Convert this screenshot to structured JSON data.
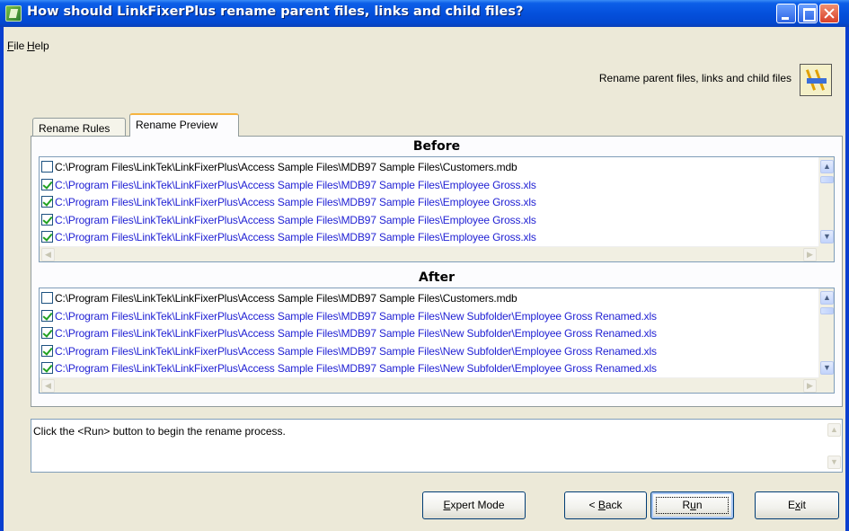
{
  "window": {
    "title": "How should LinkFixerPlus rename parent files, links and child files?"
  },
  "menu": {
    "file": "File",
    "help": "Help"
  },
  "header": {
    "text": "Rename parent files, links and child files"
  },
  "tabs": [
    {
      "label": "Rename Rules",
      "active": false
    },
    {
      "label": "Rename Preview",
      "active": true
    }
  ],
  "before": {
    "title": "Before",
    "rows": [
      {
        "checked": false,
        "blue": false,
        "text": "C:\\Program Files\\LinkTek\\LinkFixerPlus\\Access Sample Files\\MDB97 Sample Files\\Customers.mdb"
      },
      {
        "checked": true,
        "blue": true,
        "text": "C:\\Program Files\\LinkTek\\LinkFixerPlus\\Access Sample Files\\MDB97 Sample Files\\Employee Gross.xls"
      },
      {
        "checked": true,
        "blue": true,
        "text": "C:\\Program Files\\LinkTek\\LinkFixerPlus\\Access Sample Files\\MDB97 Sample Files\\Employee Gross.xls"
      },
      {
        "checked": true,
        "blue": true,
        "text": "C:\\Program Files\\LinkTek\\LinkFixerPlus\\Access Sample Files\\MDB97 Sample Files\\Employee Gross.xls"
      },
      {
        "checked": true,
        "blue": true,
        "text": "C:\\Program Files\\LinkTek\\LinkFixerPlus\\Access Sample Files\\MDB97 Sample Files\\Employee Gross.xls"
      }
    ]
  },
  "after": {
    "title": "After",
    "rows": [
      {
        "checked": false,
        "blue": false,
        "text": "C:\\Program Files\\LinkTek\\LinkFixerPlus\\Access Sample Files\\MDB97 Sample Files\\Customers.mdb"
      },
      {
        "checked": true,
        "blue": true,
        "text": "C:\\Program Files\\LinkTek\\LinkFixerPlus\\Access Sample Files\\MDB97 Sample Files\\New Subfolder\\Employee Gross Renamed.xls"
      },
      {
        "checked": true,
        "blue": true,
        "text": "C:\\Program Files\\LinkTek\\LinkFixerPlus\\Access Sample Files\\MDB97 Sample Files\\New Subfolder\\Employee Gross Renamed.xls"
      },
      {
        "checked": true,
        "blue": true,
        "text": "C:\\Program Files\\LinkTek\\LinkFixerPlus\\Access Sample Files\\MDB97 Sample Files\\New Subfolder\\Employee Gross Renamed.xls"
      },
      {
        "checked": true,
        "blue": true,
        "text": "C:\\Program Files\\LinkTek\\LinkFixerPlus\\Access Sample Files\\MDB97 Sample Files\\New Subfolder\\Employee Gross Renamed.xls"
      }
    ]
  },
  "message": {
    "text": "Click the <Run> button to begin the rename process."
  },
  "buttons": {
    "expert": "Expert Mode",
    "back": "< Back",
    "run": "Run",
    "exit": "Exit"
  },
  "icons": {
    "title": "app-icon",
    "header": "rename-road-icon"
  }
}
